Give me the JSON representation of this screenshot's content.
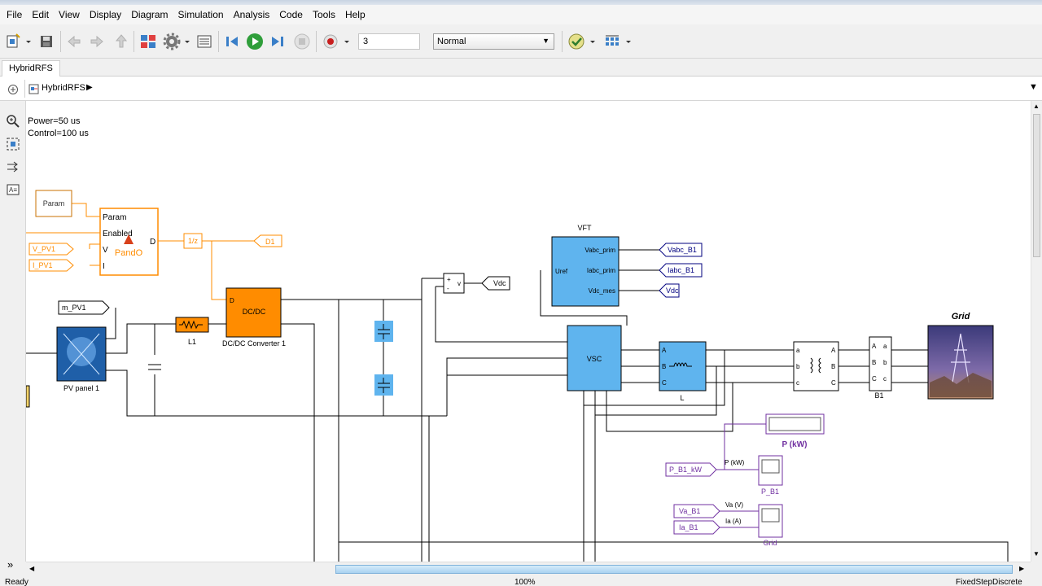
{
  "menu": [
    "File",
    "Edit",
    "View",
    "Display",
    "Diagram",
    "Simulation",
    "Analysis",
    "Code",
    "Tools",
    "Help"
  ],
  "toolbar": {
    "stop_time": "3",
    "sim_mode": "Normal"
  },
  "tabs": {
    "model_tab": "HybridRFS"
  },
  "address": {
    "breadcrumb": "HybridRFS"
  },
  "annotation": {
    "line1": "Power=50 us",
    "line2": "Control=100 us"
  },
  "blocks": {
    "param": "Param",
    "pando_port_param": "Param",
    "pando_port_enabled": "Enabled",
    "pando_port_v": "V",
    "pando_port_i": "I",
    "pando_port_d": "D",
    "pando_name": "PandO",
    "v_pv1": "V_PV1",
    "i_pv1": "I_PV1",
    "unit_delay": "1/z",
    "goto_d1": "D1",
    "m_pv1": "m_PV1",
    "pv_panel": "PV panel 1",
    "l1": "L1",
    "dcdc_label": "DC/DC",
    "dcdc_port_d": "D",
    "dcdc_name": "DC/DC Converter 1",
    "sum_plus": "+",
    "sum_minus": "-",
    "sum_v": "v",
    "goto_vdc": "Vdc",
    "vft_title": "VFT",
    "vft_uref": "Uref",
    "vft_port1": "Vabc_prim",
    "vft_port2": "Iabc_prim",
    "vft_port3": "Vdc_mes",
    "from_vabc": "Vabc_B1",
    "from_iabc": "Iabc_B1",
    "from_vdc": "Vdc",
    "vsc": "VSC",
    "l_name": "L",
    "l_a": "A",
    "l_b": "B",
    "l_c": "C",
    "tr_a": "a",
    "tr_b": "b",
    "tr_c": "c",
    "tr_A": "A",
    "tr_B": "B",
    "tr_C": "C",
    "b1_name": "B1",
    "b1_A": "A",
    "b1_B": "B",
    "b1_C": "C",
    "b1_a": "a",
    "b1_b": "b",
    "b1_c": "c",
    "grid_title": "Grid",
    "p_kw_display": "P (kW)",
    "from_pb1": "P_B1_kW",
    "sig_pkw": "P (kW)",
    "scope_pb1": "P_B1",
    "from_va": "Va_B1",
    "from_ia": "Ia_B1",
    "sig_va": "Va (V)",
    "sig_ia": "Ia (A)",
    "scope_grid": "Grid"
  },
  "status": {
    "left": "Ready",
    "center": "100%",
    "right": "FixedStepDiscrete"
  },
  "colors": {
    "orange": "#ff8c00",
    "blue": "#5fb4ee",
    "purple": "#7030a0",
    "navy": "#00007f"
  }
}
